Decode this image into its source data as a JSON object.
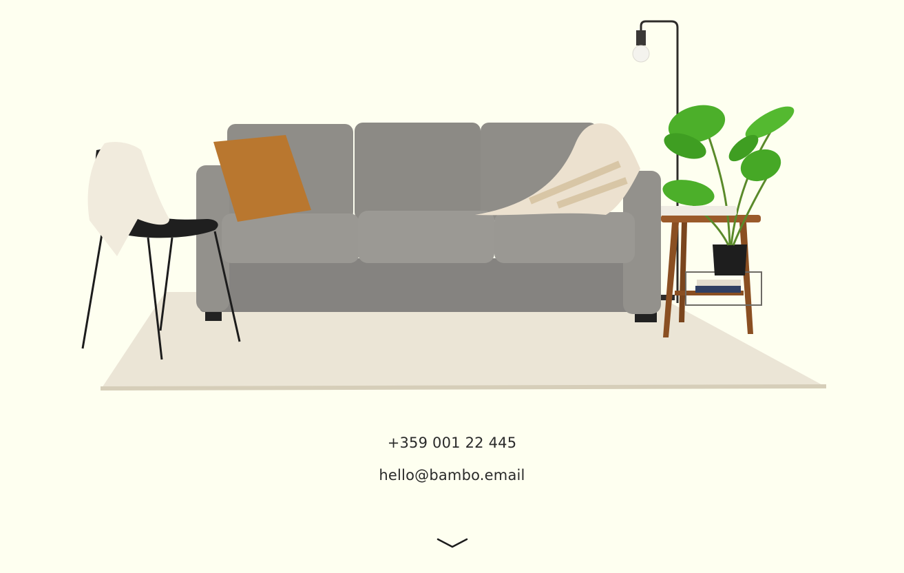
{
  "hero": {
    "image_icon": "living-room-furniture-scene"
  },
  "contact": {
    "phone": "+359 001 22 445",
    "email": "hello@bambo.email"
  },
  "scroll": {
    "icon": "chevron-down-icon"
  },
  "colors": {
    "background": "#fefff0",
    "text": "#2a2a2a",
    "sofa": "#8f8d88",
    "rug": "#ebe5d6",
    "pillow": "#b9772f",
    "plant": "#4caf2a"
  }
}
